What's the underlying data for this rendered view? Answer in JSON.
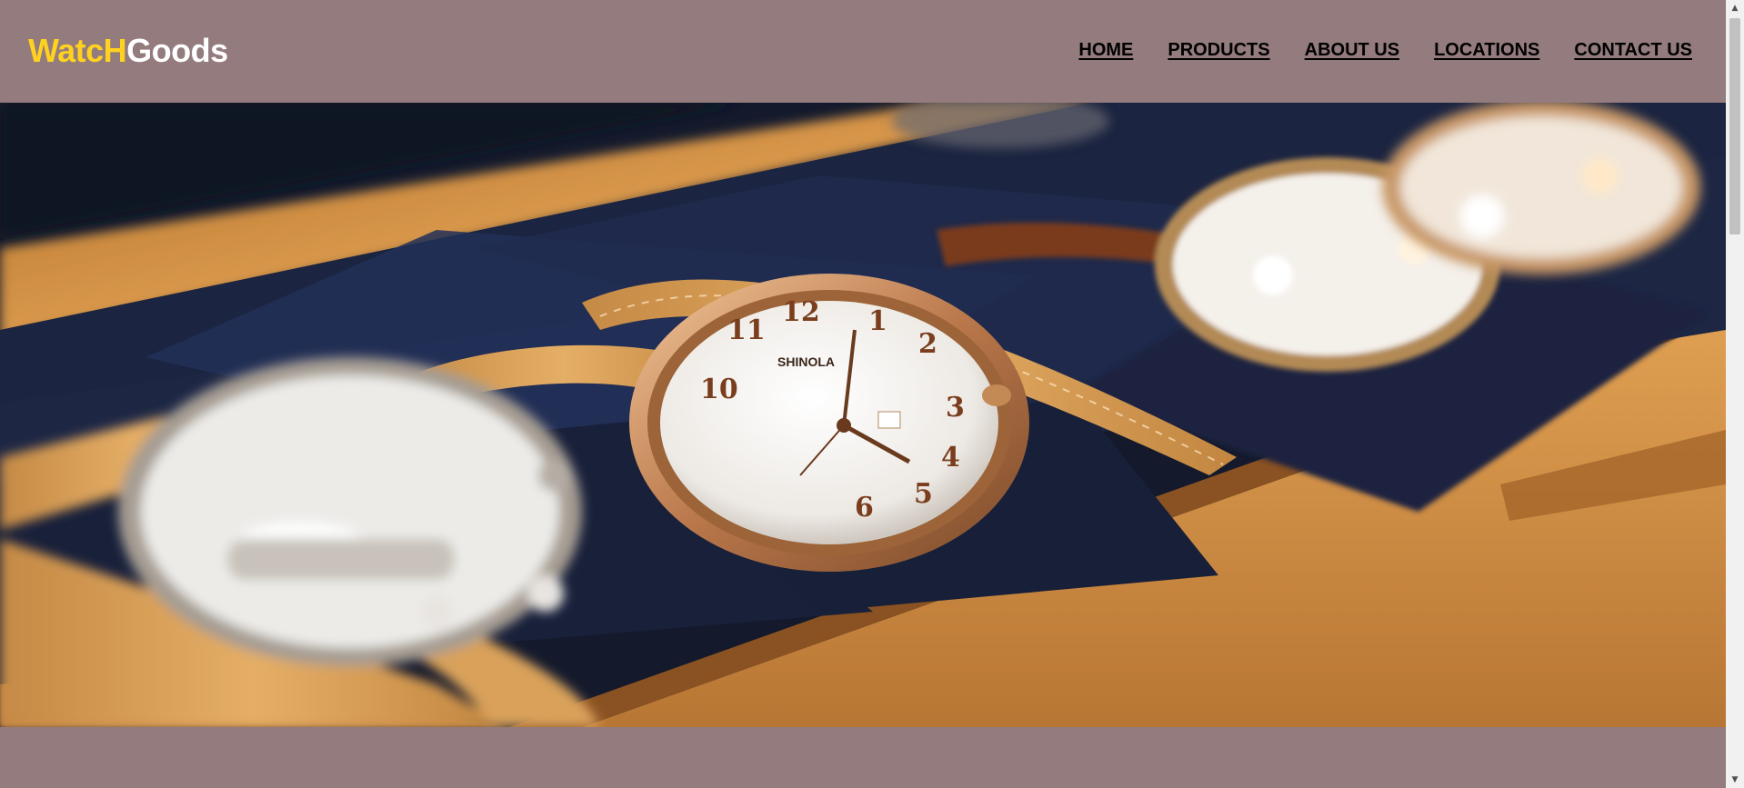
{
  "brand": {
    "part1": "WatcH",
    "part2": "Goods",
    "color1": "#FFD21F",
    "color2": "#FFFFFF"
  },
  "nav": {
    "items": [
      {
        "label": "HOME"
      },
      {
        "label": "PRODUCTS"
      },
      {
        "label": "ABOUT US"
      },
      {
        "label": "LOCATIONS"
      },
      {
        "label": "CONTACT US"
      }
    ]
  },
  "hero": {
    "image": "watch-box-photo",
    "watch_brand_text": "SHINOLA"
  },
  "colors": {
    "background": "#937B7E",
    "wood": "#C8873C",
    "tray": "#1D2744"
  }
}
